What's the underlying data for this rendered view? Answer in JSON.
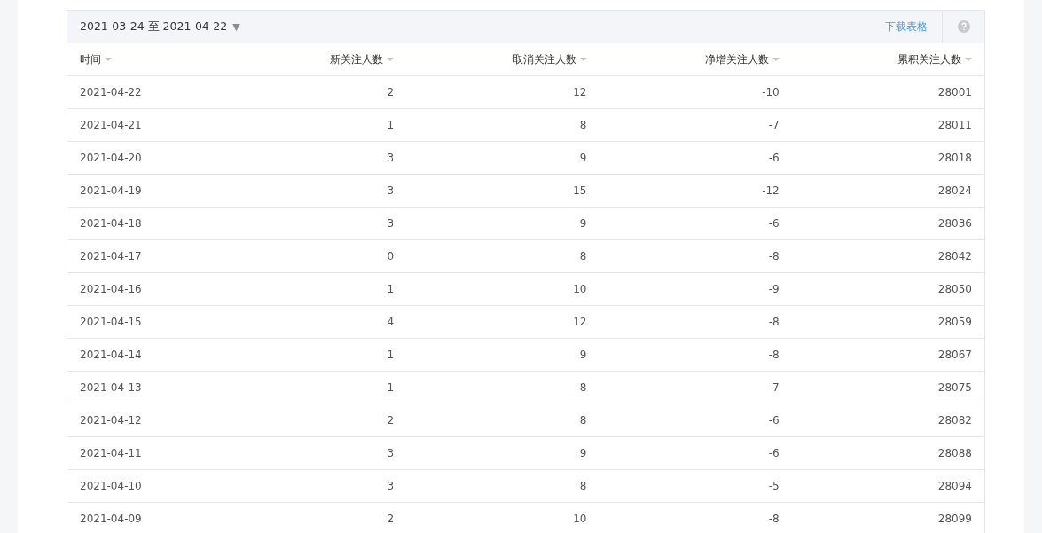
{
  "toolbar": {
    "date_range": "2021-03-24 至 2021-04-22",
    "dropdown_glyph": "▼",
    "download_link": "下载表格"
  },
  "table": {
    "columns": [
      "时间",
      "新关注人数",
      "取消关注人数",
      "净增关注人数",
      "累积关注人数"
    ],
    "rows": [
      [
        "2021-04-22",
        "2",
        "12",
        "-10",
        "28001"
      ],
      [
        "2021-04-21",
        "1",
        "8",
        "-7",
        "28011"
      ],
      [
        "2021-04-20",
        "3",
        "9",
        "-6",
        "28018"
      ],
      [
        "2021-04-19",
        "3",
        "15",
        "-12",
        "28024"
      ],
      [
        "2021-04-18",
        "3",
        "9",
        "-6",
        "28036"
      ],
      [
        "2021-04-17",
        "0",
        "8",
        "-8",
        "28042"
      ],
      [
        "2021-04-16",
        "1",
        "10",
        "-9",
        "28050"
      ],
      [
        "2021-04-15",
        "4",
        "12",
        "-8",
        "28059"
      ],
      [
        "2021-04-14",
        "1",
        "9",
        "-8",
        "28067"
      ],
      [
        "2021-04-13",
        "1",
        "8",
        "-7",
        "28075"
      ],
      [
        "2021-04-12",
        "2",
        "8",
        "-6",
        "28082"
      ],
      [
        "2021-04-11",
        "3",
        "9",
        "-6",
        "28088"
      ],
      [
        "2021-04-10",
        "3",
        "8",
        "-5",
        "28094"
      ],
      [
        "2021-04-09",
        "2",
        "10",
        "-8",
        "28099"
      ]
    ]
  }
}
